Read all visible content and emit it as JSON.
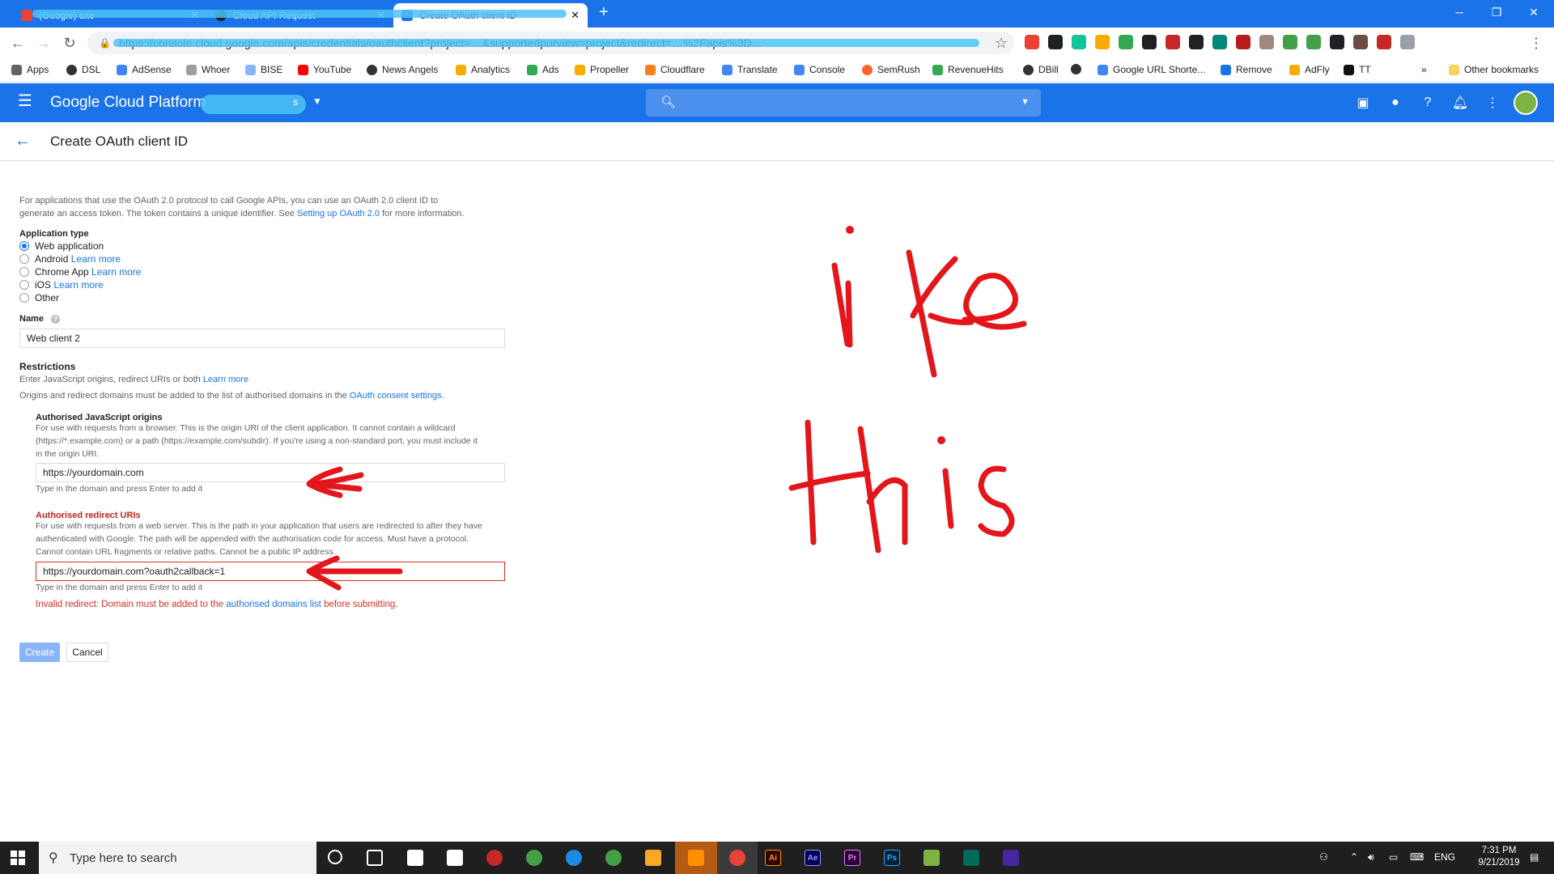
{
  "browser": {
    "tabs": [
      {
        "title": "(Google) site",
        "active": false
      },
      {
        "title": "Cloud API Request",
        "active": false
      },
      {
        "title": "Create OAuth client ID",
        "active": true
      }
    ],
    "new_tab_label": "+",
    "window_controls": {
      "minimize": "─",
      "restore": "❐",
      "close": "✕"
    },
    "url": "https://console.cloud.google.com/apis/credentials/oauthclient?project=…&supportedpurview=project&redirect=…%2Fapis%3D…",
    "extensions": [
      "gmail-ext",
      "block-ext",
      "grammarly-ext",
      "analytics-ext",
      "sheets-ext",
      "download-ext",
      "camera-ext",
      "wordtune-ext",
      "n-ext",
      "pdf-ext",
      "cookie-ext",
      "vpn-ext",
      "circle-ext",
      "arrow-ext",
      "film-ext",
      "adblock-ext",
      "edit-ext"
    ]
  },
  "bookmarks": {
    "items": [
      "Apps",
      "DSL",
      "AdSense",
      "Whoer",
      "BISE",
      "YouTube",
      "News Angels",
      "Analytics",
      "Ads",
      "Propeller",
      "Cloudflare",
      "Translate",
      "Console",
      "SemRush",
      "RevenueHits",
      "DBill",
      "",
      "Google URL Shorte...",
      "Remove",
      "AdFly",
      "TT"
    ],
    "overflow": "»",
    "other": "Other bookmarks"
  },
  "gcp": {
    "title": "Google Cloud Platform",
    "project_suffix": "s"
  },
  "page": {
    "title": "Create OAuth client ID",
    "intro_1": "For applications that use the OAuth 2.0 protocol to call Google APIs, you can use an OAuth 2.0 client ID to",
    "intro_2a": "generate an access token. The token contains a unique identifier. See ",
    "intro_2_link": "Setting up OAuth 2.0",
    "intro_2b": " for more information.",
    "app_type_label": "Application type",
    "app_types": [
      {
        "label": "Web application",
        "link": "",
        "selected": true
      },
      {
        "label": "Android",
        "link": "Learn more",
        "selected": false
      },
      {
        "label": "Chrome App",
        "link": "Learn more",
        "selected": false
      },
      {
        "label": "iOS",
        "link": "Learn more",
        "selected": false
      },
      {
        "label": "Other",
        "link": "",
        "selected": false
      }
    ],
    "name_label": "Name",
    "name_value": "Web client 2",
    "restrictions_label": "Restrictions",
    "restrictions_1": "Enter JavaScript origins, redirect URIs or both ",
    "restrictions_1_link": "Learn more",
    "restrictions_2": "Origins and redirect domains must be added to the list of authorised domains in the ",
    "restrictions_2_link": "OAuth consent settings",
    "restrictions_2_end": ".",
    "js_origins_label": "Authorised JavaScript origins",
    "js_origins_help_1": "For use with requests from a browser. This is the origin URI of the client application. It cannot contain a wildcard",
    "js_origins_help_2": "(https://*.example.com) or a path (https://example.com/subdir). If you're using a non-standard port, you must include it",
    "js_origins_help_3": "in the origin URI.",
    "js_origin_value": "https://yourdomain.com",
    "js_origin_hint": "Type in the domain and press Enter to add it",
    "redirect_label": "Authorised redirect URIs",
    "redirect_help_1": "For use with requests from a web server. This is the path in your application that users are redirected to after they have",
    "redirect_help_2": "authenticated with Google. The path will be appended with the authorisation code for access. Must have a protocol.",
    "redirect_help_3": "Cannot contain URL fragments or relative paths. Cannot be a public IP address.",
    "redirect_value": "https://yourdomain.com?oauth2callback=1",
    "redirect_hint": "Type in the domain and press Enter to add it",
    "error_a": "Invalid redirect: Domain must be added to the ",
    "error_link": "authorised domains list",
    "error_b": " before submitting.",
    "create_label": "Create",
    "cancel_label": "Cancel"
  },
  "annotation": {
    "line1": "like",
    "line2": "this",
    "color": "#e3161b"
  },
  "taskbar": {
    "search_placeholder": "Type here to search",
    "apps": [
      "cortana-icon",
      "task-view-icon",
      "store-icon",
      "mail-icon",
      "app-icon",
      "xbox-icon",
      "edge-icon",
      "photos-icon",
      "explorer-icon",
      "vlc-icon",
      "chrome-icon",
      "illustrator-icon",
      "after-effects-icon",
      "premiere-icon",
      "photoshop-icon",
      "camtasia-icon",
      "app2-icon",
      "app3-icon"
    ],
    "app_labels": {
      "illustrator": "Ai",
      "after_effects": "Ae",
      "premiere": "Pr",
      "photoshop": "Ps"
    },
    "lang": "ENG",
    "time": "7:31 PM",
    "date": "9/21/2019"
  }
}
